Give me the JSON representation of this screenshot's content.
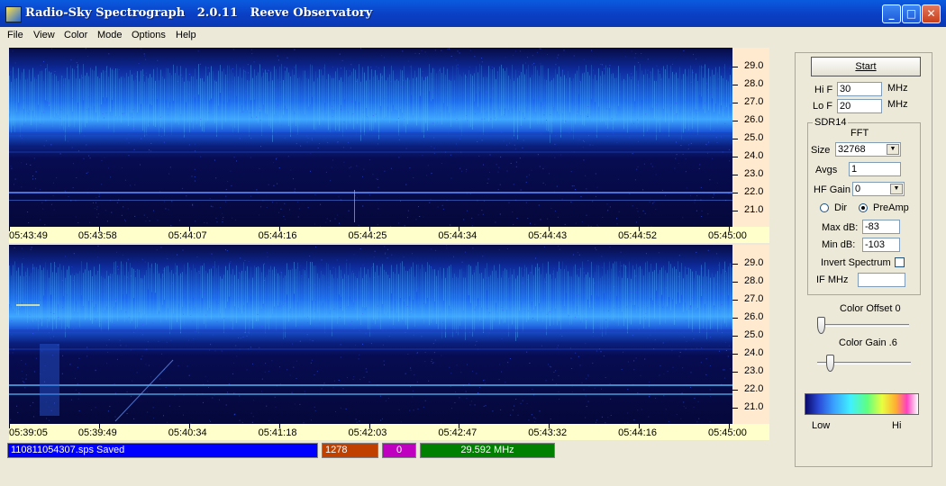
{
  "window": {
    "title": "Radio-Sky Spectrograph   2.0.11   Reeve Observatory",
    "minimize": "_",
    "maximize": "□",
    "close": "✕"
  },
  "menu": [
    "File",
    "View",
    "Color",
    "Mode",
    "Options",
    "Help"
  ],
  "top_panel": {
    "freq_labels": [
      "29.0",
      "28.0",
      "27.0",
      "26.0",
      "25.0",
      "24.0",
      "23.0",
      "22.0",
      "21.0"
    ],
    "time_labels": [
      "05:43:49",
      "05:43:58",
      "05:44:07",
      "05:44:16",
      "05:44:25",
      "05:44:34",
      "05:44:43",
      "05:44:52",
      "05:45:00"
    ]
  },
  "bottom_panel": {
    "freq_labels": [
      "29.0",
      "28.0",
      "27.0",
      "26.0",
      "25.0",
      "24.0",
      "23.0",
      "22.0",
      "21.0"
    ],
    "time_labels": [
      "05:39:05",
      "05:39:49",
      "05:40:34",
      "05:41:18",
      "05:42:03",
      "05:42:47",
      "05:43:32",
      "05:44:16",
      "05:45:00"
    ]
  },
  "status": {
    "file_saved": "110811054307.sps Saved",
    "count": "1278",
    "zero": "0",
    "frequency": "29.592 MHz",
    "colors": {
      "file": "#0000FF",
      "count": "#C04000",
      "zero": "#C000C0",
      "frequency": "#008000"
    }
  },
  "controls": {
    "start_label": "Start",
    "hi_f_label": "Hi F",
    "hi_f_value": "30",
    "hi_f_unit": "MHz",
    "lo_f_label": "Lo F",
    "lo_f_value": "20",
    "lo_f_unit": "MHz",
    "group_label": "SDR14",
    "fft_label": "FFT",
    "size_label": "Size",
    "size_value": "32768",
    "avgs_label": "Avgs",
    "avgs_value": "1",
    "hf_gain_label": "HF Gain",
    "hf_gain_value": "0",
    "dir_label": "Dir",
    "preamp_label": "PreAmp",
    "selected_mode": "PreAmp",
    "max_db_label": "Max dB:",
    "max_db_value": "-83",
    "min_db_label": "Min dB:",
    "min_db_value": "-103",
    "invert_label": "Invert Spectrum",
    "invert_checked": false,
    "if_mhz_label": "IF MHz",
    "if_mhz_value": "",
    "color_offset_label": "Color Offset 0",
    "color_offset_level": 0,
    "color_gain_label": "Color Gain .6",
    "color_gain_level": 0.06,
    "low_label": "Low",
    "hi_label": "Hi"
  },
  "theme": {
    "background": "#060a3e",
    "signal_bright": "#3fa8ff",
    "freq_axis_bg": "#FFE9CF",
    "time_axis_bg": "#FFFFCC"
  }
}
